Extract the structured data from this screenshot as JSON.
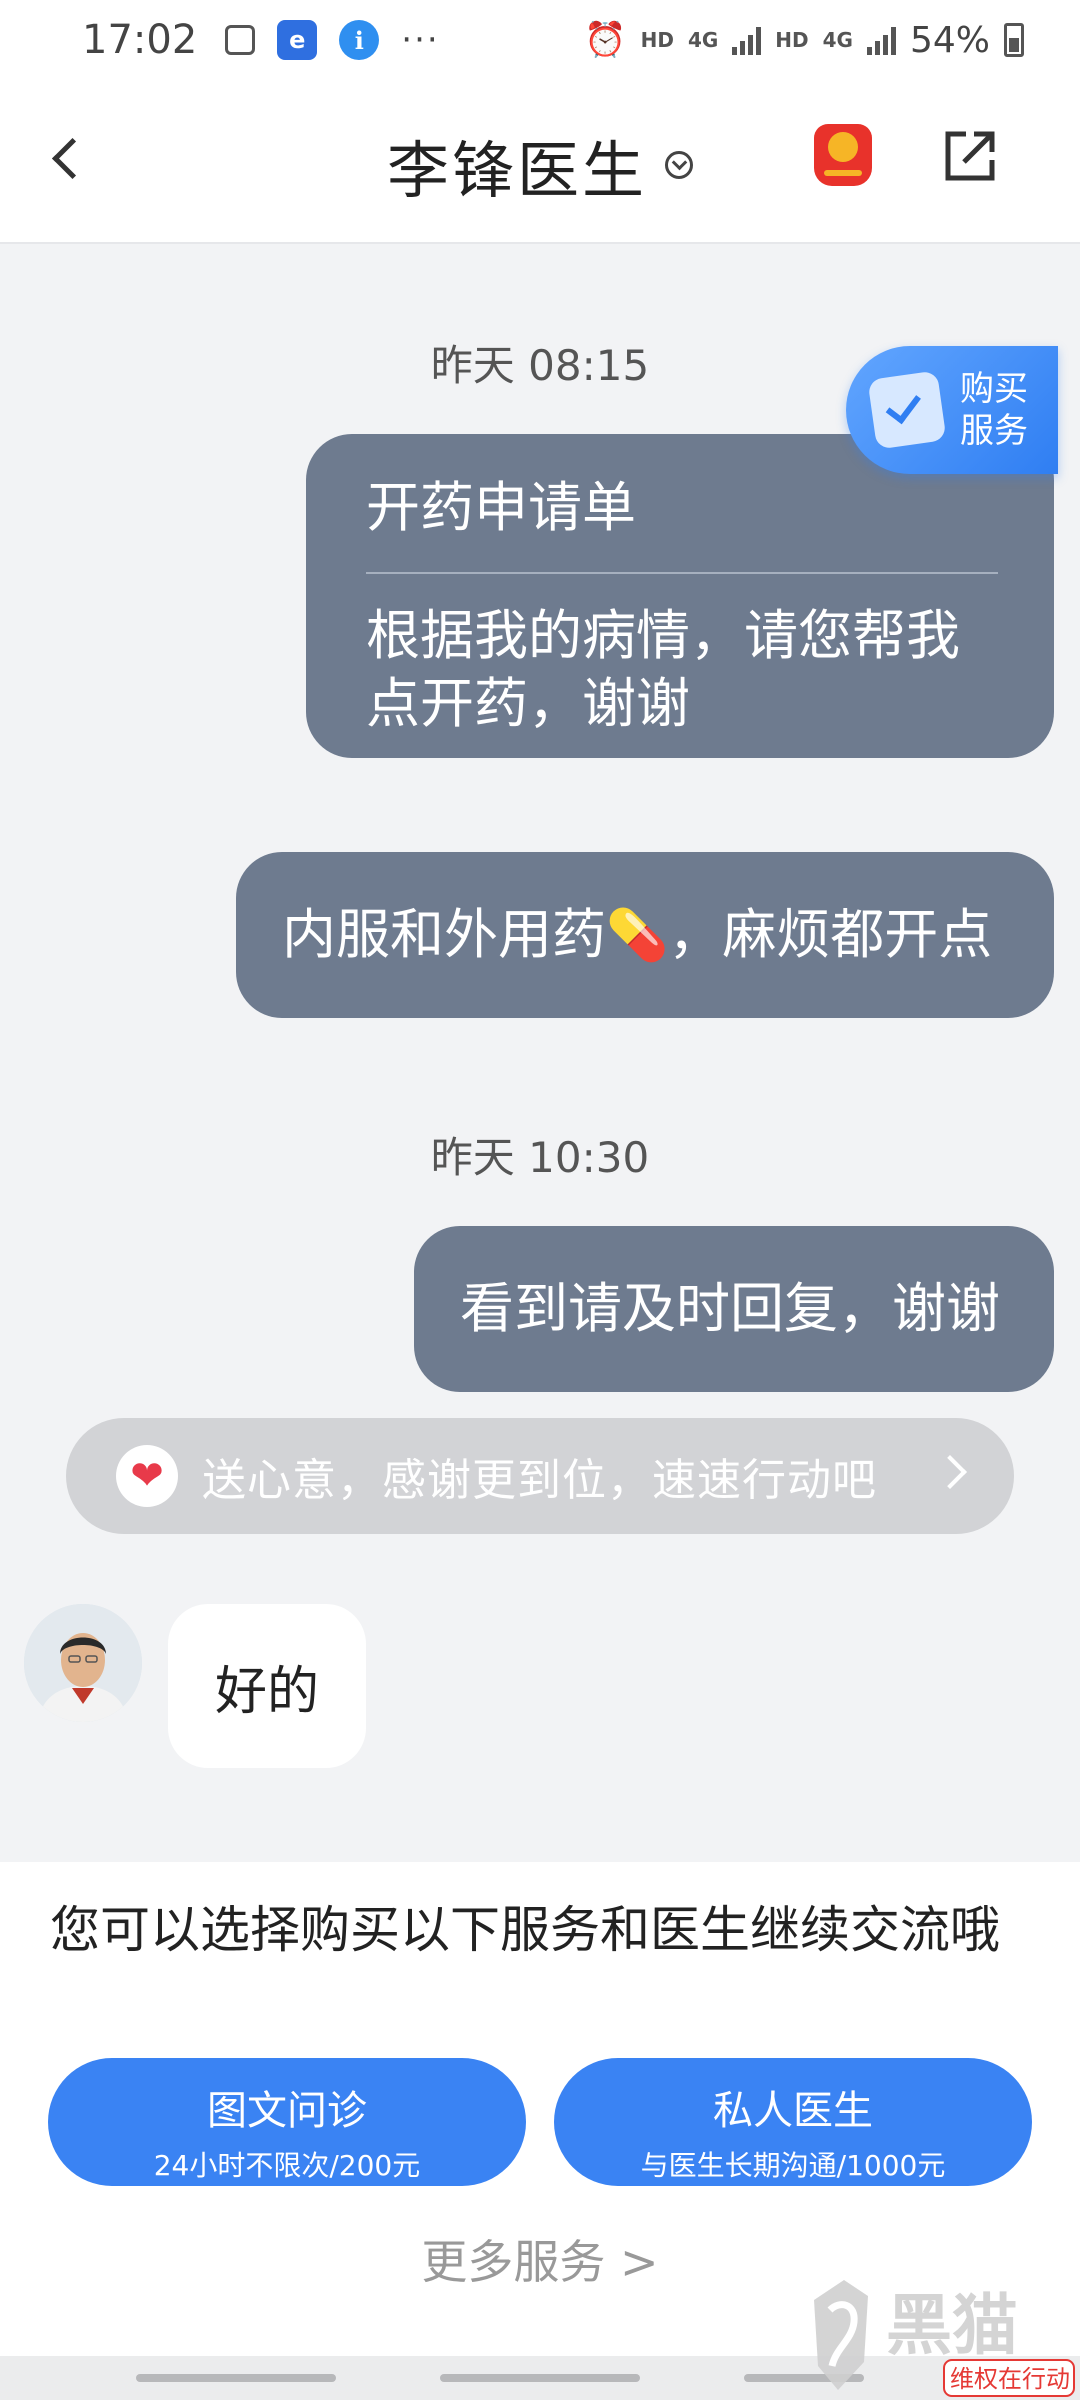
{
  "status_bar": {
    "time": "17:02",
    "network_1": "HD",
    "network_1_type": "4G",
    "network_2": "HD",
    "network_2_type": "4G",
    "battery": "54%"
  },
  "nav": {
    "title": "李锋医生"
  },
  "chat": {
    "messages": [
      {
        "timestamp": "昨天 08:15"
      },
      {
        "card_title": "开药申请单",
        "card_body": "根据我的病情，请您帮我点开药，谢谢"
      },
      {
        "text_before": "内服和外用药",
        "emoji": "💊",
        "text_after": "，麻烦都开点"
      },
      {
        "timestamp": "昨天 10:30"
      },
      {
        "text": "看到请及时回复，谢谢"
      }
    ],
    "buy_badge": "购买服务",
    "gift_prompt": "送心意，感谢更到位，速速行动吧",
    "doctor_reply": "好的"
  },
  "services": {
    "prompt": "您可以选择购买以下服务和医生继续交流哦",
    "options": [
      {
        "title": "图文问诊",
        "subtitle": "24小时不限次/200元"
      },
      {
        "title": "私人医生",
        "subtitle": "与医生长期沟通/1000元"
      }
    ],
    "more": "更多服务 >"
  },
  "watermark": {
    "text": "黑猫",
    "subtext": "维权在行动"
  },
  "colors": {
    "outgoing_bubble": "#6e7b8f",
    "service_button": "#3a83f3",
    "gift_bar": "#d2d3d6",
    "badge_red": "#e8322b"
  }
}
